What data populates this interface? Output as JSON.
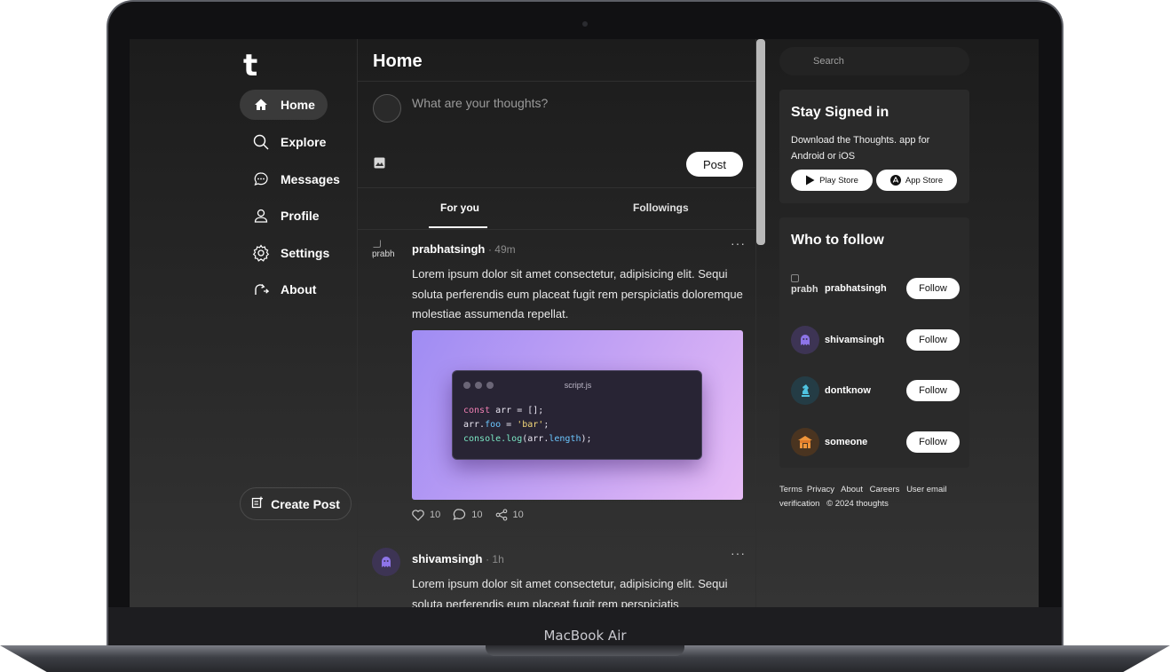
{
  "device": {
    "label": "MacBook Air"
  },
  "app": {
    "logo": "t"
  },
  "sidebar": {
    "items": [
      {
        "label": "Home",
        "icon": "home-icon",
        "active": true
      },
      {
        "label": "Explore",
        "icon": "search-icon"
      },
      {
        "label": "Messages",
        "icon": "chat-bubble-icon"
      },
      {
        "label": "Profile",
        "icon": "user-icon"
      },
      {
        "label": "Settings",
        "icon": "gear-icon"
      },
      {
        "label": "About",
        "icon": "about-icon"
      }
    ],
    "create_post": "Create Post"
  },
  "main": {
    "title": "Home",
    "composer": {
      "placeholder": "What are your thoughts?",
      "post_button": "Post"
    },
    "tabs": [
      {
        "label": "For you",
        "active": true
      },
      {
        "label": "Followings"
      }
    ],
    "posts": [
      {
        "avatar_alt": "prabh",
        "author": "prabhatsingh",
        "time": "· 49m",
        "more": "···",
        "text": "Lorem ipsum dolor sit amet consectetur, adipisicing elit. Sequi soluta perferendis eum placeat fugit rem perspiciatis doloremque molestiae assumenda repellat.",
        "image": {
          "file_name": "script.js",
          "code": [
            "const arr = [];",
            "arr.foo = 'bar';",
            "console.log(arr.length);"
          ]
        },
        "likes": "10",
        "comments": "10",
        "shares": "10"
      },
      {
        "author": "shivamsingh",
        "time": "· 1h",
        "more": "···",
        "text": "Lorem ipsum dolor sit amet consectetur, adipisicing elit. Sequi soluta perferendis eum placeat fugit rem perspiciatis"
      }
    ]
  },
  "right": {
    "search_placeholder": "Search",
    "stay_signed_in": {
      "title": "Stay Signed in",
      "description": "Download the Thoughts. app for Android or iOS",
      "play_store": "Play Store",
      "app_store": "App Store"
    },
    "who_to_follow": {
      "title": "Who to follow",
      "users": [
        {
          "name": "prabhatsingh",
          "avatar_alt": "prabh",
          "button": "Follow"
        },
        {
          "name": "shivamsingh",
          "button": "Follow",
          "avatar_color": "#5b4a8a"
        },
        {
          "name": "dontknow",
          "button": "Follow",
          "avatar_color": "#2c6f80"
        },
        {
          "name": "someone",
          "button": "Follow",
          "avatar_color": "#c77a2d"
        }
      ]
    },
    "footer": {
      "links": [
        "Terms",
        "Privacy",
        "About",
        "Careers",
        "User email verification"
      ],
      "copyright": "© 2024 thoughts"
    }
  }
}
